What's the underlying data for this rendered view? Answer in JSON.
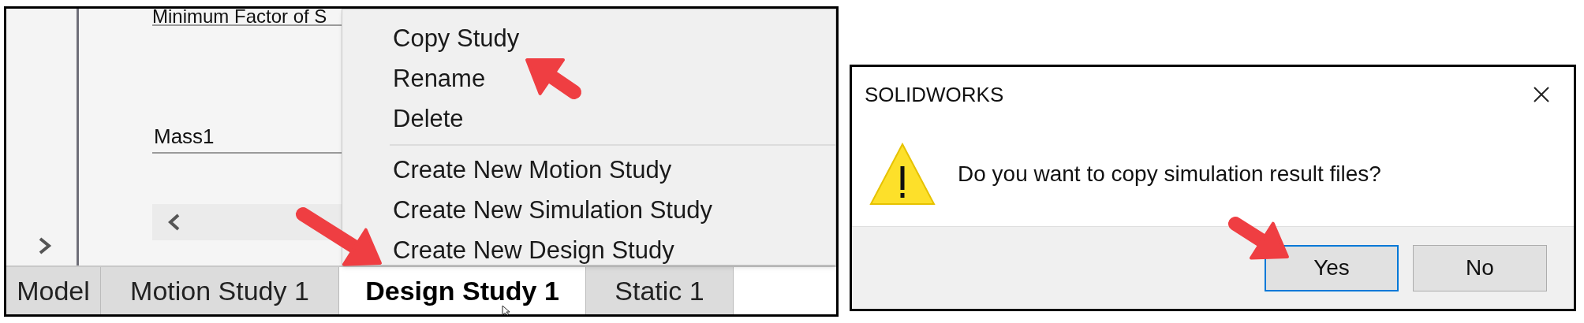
{
  "table": {
    "rows": [
      {
        "label": "Minimum Factor of S"
      },
      {
        "label": "Mass1"
      }
    ]
  },
  "context_menu": {
    "sections": [
      [
        {
          "label": "Copy Study"
        },
        {
          "label": "Rename"
        },
        {
          "label": "Delete"
        }
      ],
      [
        {
          "label": "Create New Motion Study"
        },
        {
          "label": "Create New Simulation Study"
        },
        {
          "label": "Create New Design Study"
        }
      ]
    ]
  },
  "tabs": [
    {
      "label": "Model",
      "selected": false
    },
    {
      "label": "Motion Study 1",
      "selected": false
    },
    {
      "label": "Design Study 1",
      "selected": true
    },
    {
      "label": "Static 1",
      "selected": false
    }
  ],
  "dialog": {
    "title": "SOLIDWORKS",
    "message": "Do you want to copy simulation result files?",
    "buttons": [
      {
        "label": "Yes",
        "focused": true
      },
      {
        "label": "No",
        "focused": false
      }
    ]
  }
}
